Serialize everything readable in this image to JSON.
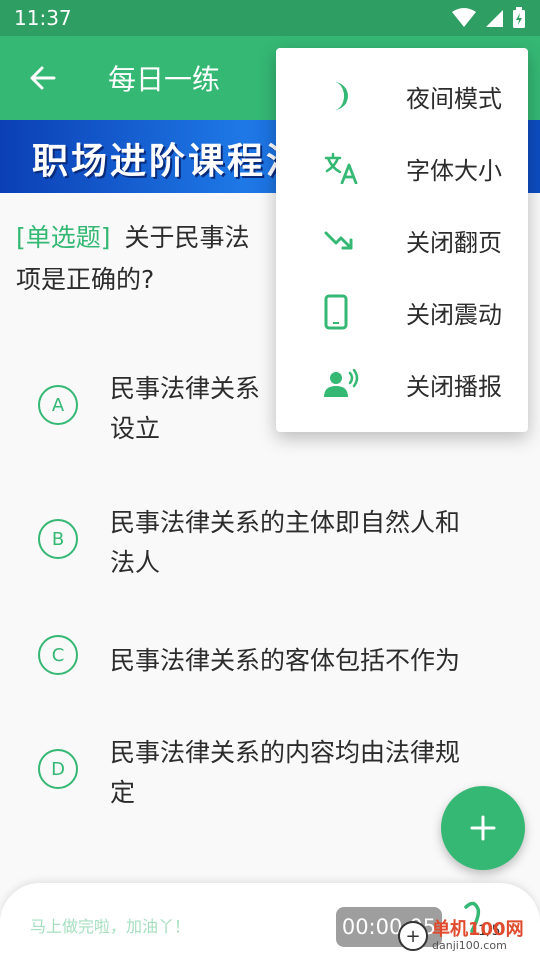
{
  "status": {
    "time": "11:37"
  },
  "app_bar": {
    "title": "每日一练"
  },
  "banner": {
    "text": "职场进阶课程汇"
  },
  "question": {
    "type_tag": "[单选题]",
    "text_line1": "关于民事法",
    "text_line2": "项是正确的?"
  },
  "options": [
    {
      "letter": "A",
      "line1": "民事法律关系",
      "line2": "设立"
    },
    {
      "letter": "B",
      "line1": "民事法律关系的主体即自然人和",
      "line2": "法人"
    },
    {
      "letter": "C",
      "line1": "民事法律关系的客体包括不作为",
      "line2": ""
    },
    {
      "letter": "D",
      "line1": "民事法律关系的内容均由法律规",
      "line2": "定"
    }
  ],
  "menu": {
    "items": [
      {
        "label": "夜间模式",
        "icon": "moon-icon"
      },
      {
        "label": "字体大小",
        "icon": "translate-icon"
      },
      {
        "label": "关闭翻页",
        "icon": "arrow-down-right-icon"
      },
      {
        "label": "关闭震动",
        "icon": "phone-icon"
      },
      {
        "label": "关闭播报",
        "icon": "voice-icon"
      }
    ]
  },
  "bottom": {
    "encourage": "马上做完啦，加油丫！",
    "timer": "00:00:05",
    "progress": "1/5"
  },
  "watermark": {
    "cn": "单机100网",
    "url": "danji100.com"
  },
  "colors": {
    "primary": "#35b874",
    "status_bar": "#2e9e63"
  }
}
